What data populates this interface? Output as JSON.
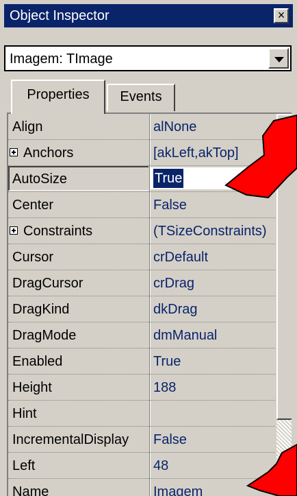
{
  "window": {
    "title": "Object Inspector",
    "close_label": "×"
  },
  "object_selector": {
    "value": "Imagem: TImage"
  },
  "tabs": [
    {
      "label": "Properties"
    },
    {
      "label": "Events"
    }
  ],
  "properties": [
    {
      "name": "Align",
      "value": "alNone",
      "expandable": false
    },
    {
      "name": "Anchors",
      "value": "[akLeft,akTop]",
      "expandable": true
    },
    {
      "name": "AutoSize",
      "value": "True",
      "expandable": false,
      "selected": true
    },
    {
      "name": "Center",
      "value": "False",
      "expandable": false
    },
    {
      "name": "Constraints",
      "value": "(TSizeConstraints)",
      "expandable": true
    },
    {
      "name": "Cursor",
      "value": "crDefault",
      "expandable": false
    },
    {
      "name": "DragCursor",
      "value": "crDrag",
      "expandable": false
    },
    {
      "name": "DragKind",
      "value": "dkDrag",
      "expandable": false
    },
    {
      "name": "DragMode",
      "value": "dmManual",
      "expandable": false
    },
    {
      "name": "Enabled",
      "value": "True",
      "expandable": false
    },
    {
      "name": "Height",
      "value": "188",
      "expandable": false
    },
    {
      "name": "Hint",
      "value": "",
      "expandable": false
    },
    {
      "name": "IncrementalDisplay",
      "value": "False",
      "expandable": false
    },
    {
      "name": "Left",
      "value": "48",
      "expandable": false
    },
    {
      "name": "Name",
      "value": "Imagem",
      "expandable": false
    }
  ],
  "colors": {
    "titlebar": "#0a246a",
    "value_text": "#0a246a",
    "arrow": "#ff0000"
  }
}
